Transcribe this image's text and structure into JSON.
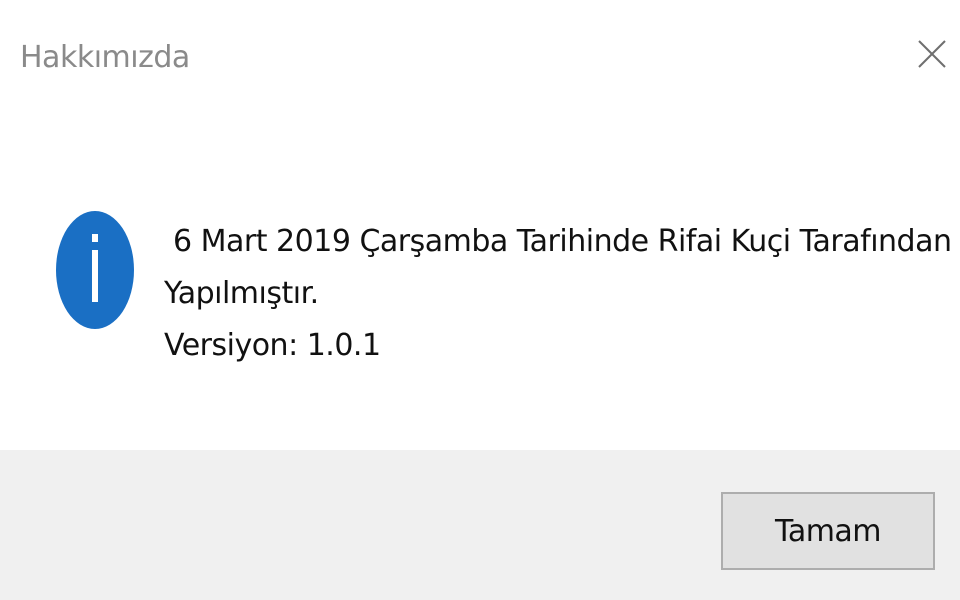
{
  "dialog": {
    "title": "Hakkımızda",
    "message_line1": " 6 Mart 2019 Çarşamba Tarihinde Rifai Kuçi Tarafından",
    "message_line2": "Yapılmıştır.",
    "message_line3": "Versiyon: 1.0.1",
    "ok_label": "Tamam",
    "icons": {
      "close": "close-icon",
      "info": "info-icon"
    },
    "colors": {
      "info_blue": "#1a6fc4",
      "footer_bg": "#f0f0f0",
      "button_bg": "#e1e1e1",
      "button_border": "#adadad",
      "title_gray": "#8a8a8a"
    }
  }
}
